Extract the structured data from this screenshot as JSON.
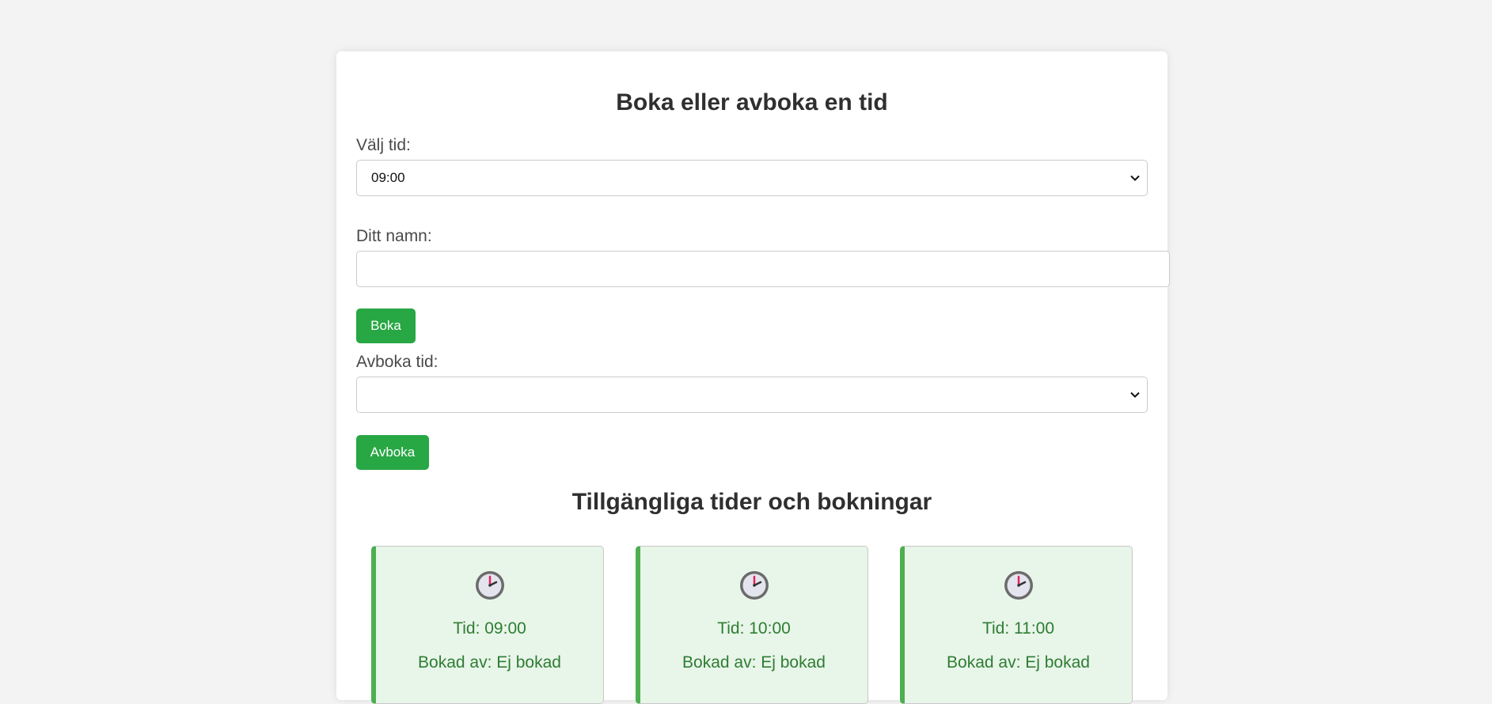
{
  "booking": {
    "heading": "Boka eller avboka en tid",
    "time_label": "Välj tid:",
    "time_selected": "09:00",
    "name_label": "Ditt namn:",
    "name_value": "",
    "book_button": "Boka",
    "cancel_label": "Avboka tid:",
    "cancel_selected": "",
    "cancel_button": "Avboka"
  },
  "availability": {
    "heading": "Tillgängliga tider och bokningar",
    "slots": [
      {
        "time": "Tid: 09:00",
        "booked_by": "Bokad av: Ej bokad",
        "icon": "clock-icon"
      },
      {
        "time": "Tid: 10:00",
        "booked_by": "Bokad av: Ej bokad",
        "icon": "clock-icon"
      },
      {
        "time": "Tid: 11:00",
        "booked_by": "Bokad av: Ej bokad",
        "icon": "clock-icon"
      }
    ]
  },
  "colors": {
    "accent_green": "#28a745",
    "slot_background": "#e8f5e9",
    "slot_border": "#4caf50",
    "slot_text": "#2e7d32"
  }
}
